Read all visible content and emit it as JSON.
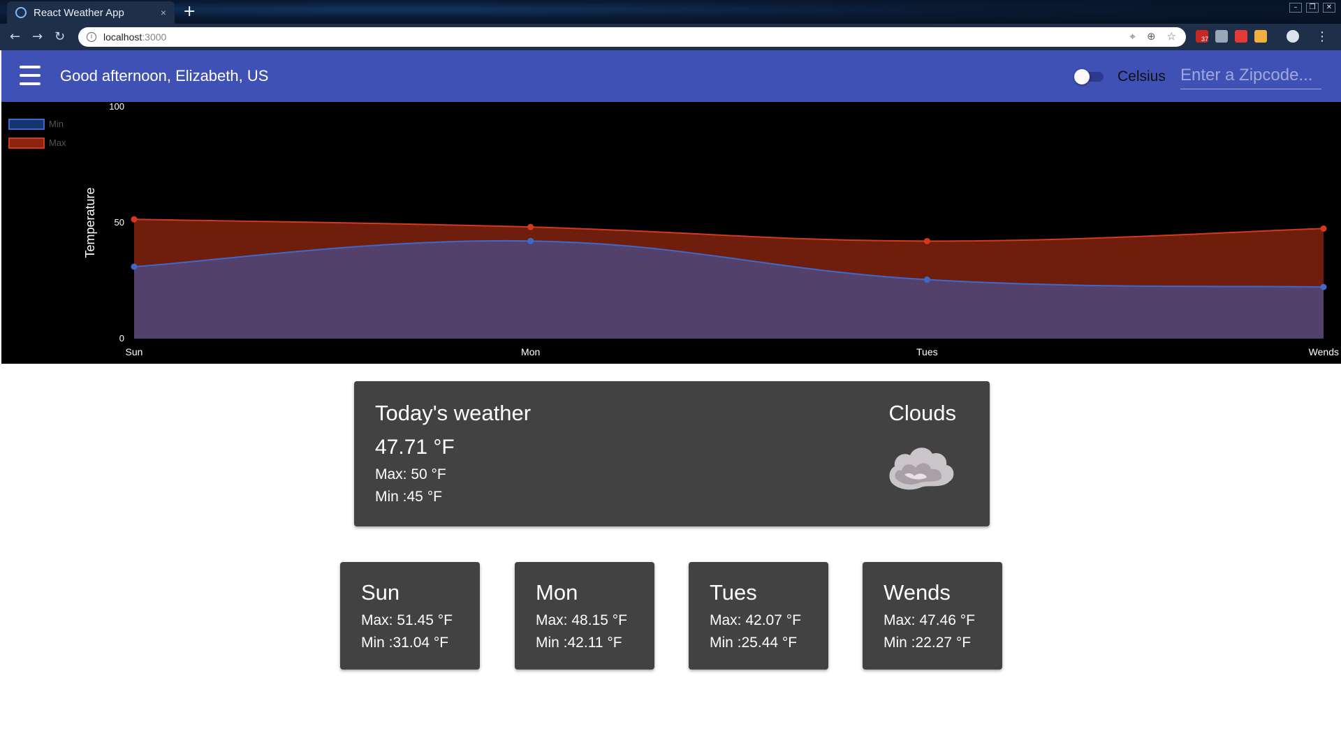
{
  "browser": {
    "tab_title": "React Weather App",
    "tab_close": "×",
    "new_tab": "+",
    "url_host": "localhost",
    "url_port": ":3000",
    "extension_badge": "37"
  },
  "appbar": {
    "greeting": "Good afternoon, Elizabeth, US",
    "unit_label": "Celsius",
    "celsius_on": false,
    "zip_placeholder": "Enter a Zipcode..."
  },
  "colors": {
    "appbar": "#3f51b5",
    "min_series": "#3f68c9",
    "min_fill": "#54416b",
    "max_series": "#d33a1c",
    "max_fill": "#6f1d0c",
    "card": "#424242"
  },
  "chart_data": {
    "type": "area",
    "x": [
      "Sun",
      "Mon",
      "Tues",
      "Wends"
    ],
    "series": [
      {
        "name": "Min",
        "values": [
          31.04,
          42.11,
          25.44,
          22.27
        ]
      },
      {
        "name": "Max",
        "values": [
          51.45,
          48.15,
          42.07,
          47.46
        ]
      }
    ],
    "ylabel": "Temperature",
    "yticks": [
      "0",
      "50",
      "100"
    ],
    "ylim": [
      0,
      100
    ],
    "legend": "top-left",
    "grid": false
  },
  "today": {
    "title": "Today's weather",
    "temp": "47.71 °F",
    "max": "Max: 50 °F",
    "min": "Min :45 °F",
    "condition": "Clouds",
    "icon": "clouds-icon"
  },
  "forecast": [
    {
      "day": "Sun",
      "max": "Max: 51.45 °F",
      "min": "Min :31.04 °F"
    },
    {
      "day": "Mon",
      "max": "Max: 48.15 °F",
      "min": "Min :42.11 °F"
    },
    {
      "day": "Tues",
      "max": "Max: 42.07 °F",
      "min": "Min :25.44 °F"
    },
    {
      "day": "Wends",
      "max": "Max: 47.46 °F",
      "min": "Min :22.27 °F"
    }
  ]
}
